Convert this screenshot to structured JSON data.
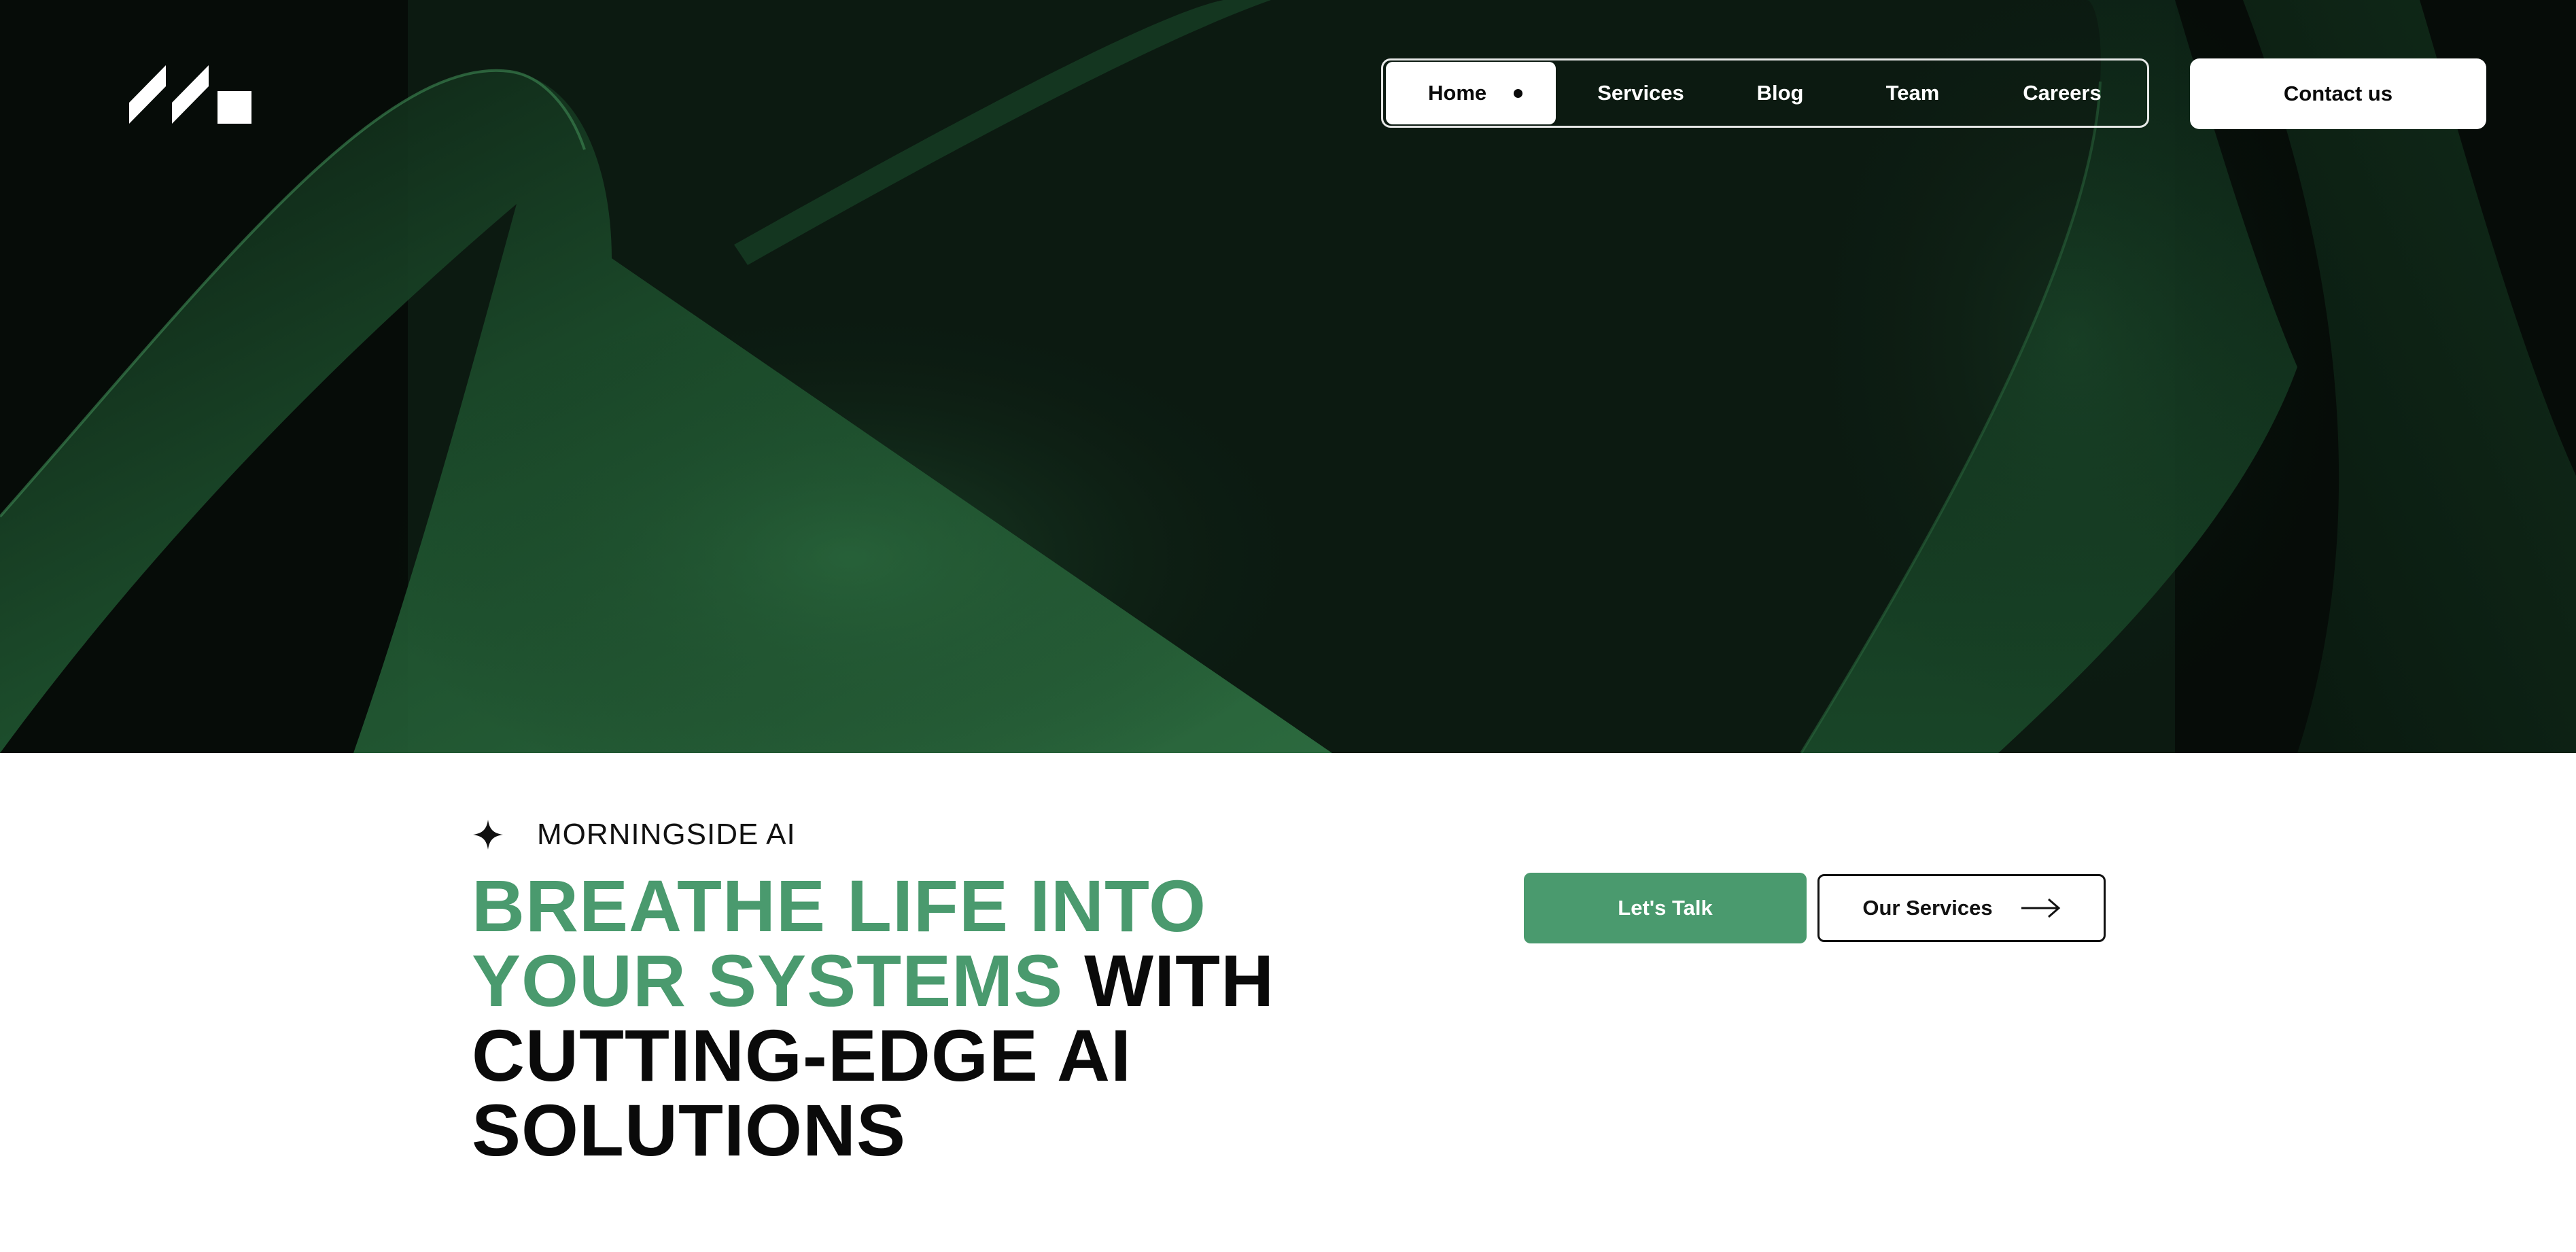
{
  "brand": {
    "logo_icon": "morningside-logo-mark"
  },
  "nav": {
    "items": [
      {
        "label": "Home",
        "active": true
      },
      {
        "label": "Services"
      },
      {
        "label": "Blog"
      },
      {
        "label": "Team"
      },
      {
        "label": "Careers"
      }
    ],
    "contact_label": "Contact us"
  },
  "hero": {
    "eyebrow_icon": "sparkle-icon",
    "eyebrow": "MORNINGSIDE AI",
    "headline_accent_1": "BREATHE LIFE INTO",
    "headline_accent_2": "YOUR SYSTEMS",
    "headline_rest_1": "WITH",
    "headline_rest_2": "CUTTING-EDGE AI",
    "headline_rest_3": "SOLUTIONS"
  },
  "cta": {
    "primary_label": "Let's Talk",
    "secondary_label": "Our Services",
    "secondary_icon": "arrow-right-icon"
  },
  "colors": {
    "accent": "#4a9a6e",
    "hero_bg": "#050a07",
    "text": "#0a0a0a"
  }
}
